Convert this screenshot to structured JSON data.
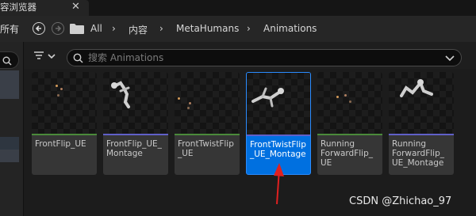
{
  "tab": {
    "title": "容浏览器",
    "close": "✕"
  },
  "toolbar": {
    "left_label": "所有",
    "breadcrumbs": [
      "All",
      "内容",
      "MetaHumans",
      "Animations"
    ],
    "separator": "›"
  },
  "search": {
    "placeholder": "搜索 Animations"
  },
  "assets": [
    {
      "label": "FrontFlip_UE",
      "stripe": "#4a8a3a",
      "selected": false
    },
    {
      "label": "FrontFlip_UE_\nMontage",
      "stripe": "#6060c8",
      "selected": false
    },
    {
      "label": "FrontTwistFlip\n_UE",
      "stripe": "#4a8a3a",
      "selected": false
    },
    {
      "label": "FrontTwistFlip\n_UE_Montage",
      "stripe": "#6060c8",
      "selected": true
    },
    {
      "label": "Running\nForwardFlip_\nUE",
      "stripe": "#4a8a3a",
      "selected": false
    },
    {
      "label": "Running\nForwardFlip_\nUE_Montage",
      "stripe": "#6060c8",
      "selected": false
    }
  ],
  "annotation_arrow_color": "#e02020",
  "watermark": "CSDN @Zhichao_97"
}
